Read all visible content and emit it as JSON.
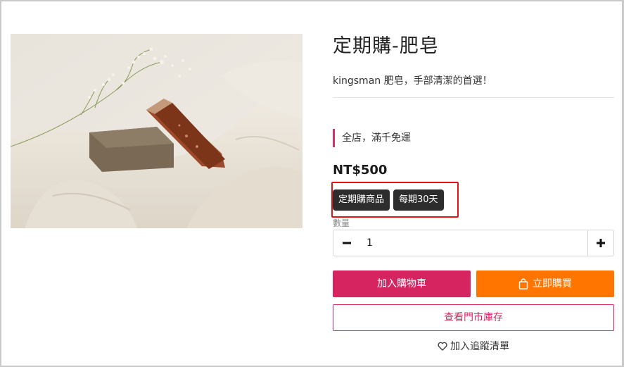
{
  "product": {
    "title": "定期購-肥皂",
    "subtitle": "kingsman 肥皂，手部清潔的首選！",
    "promo": "全店，滿千免運",
    "price": "NT$500",
    "tags": [
      "定期購商品",
      "每期30天"
    ]
  },
  "quantity": {
    "label": "數量",
    "value": "1",
    "minus_icon": "minus-icon",
    "plus_icon": "plus-icon"
  },
  "actions": {
    "add_to_cart": "加入購物車",
    "buy_now": "立即購買",
    "check_stock": "查看門市庫存",
    "wishlist": "加入追蹤清單"
  },
  "colors": {
    "brand_pink": "#d5245f",
    "buy_orange": "#ff7500",
    "tag_dark": "#2d2d2d",
    "highlight_red": "#e01616"
  }
}
